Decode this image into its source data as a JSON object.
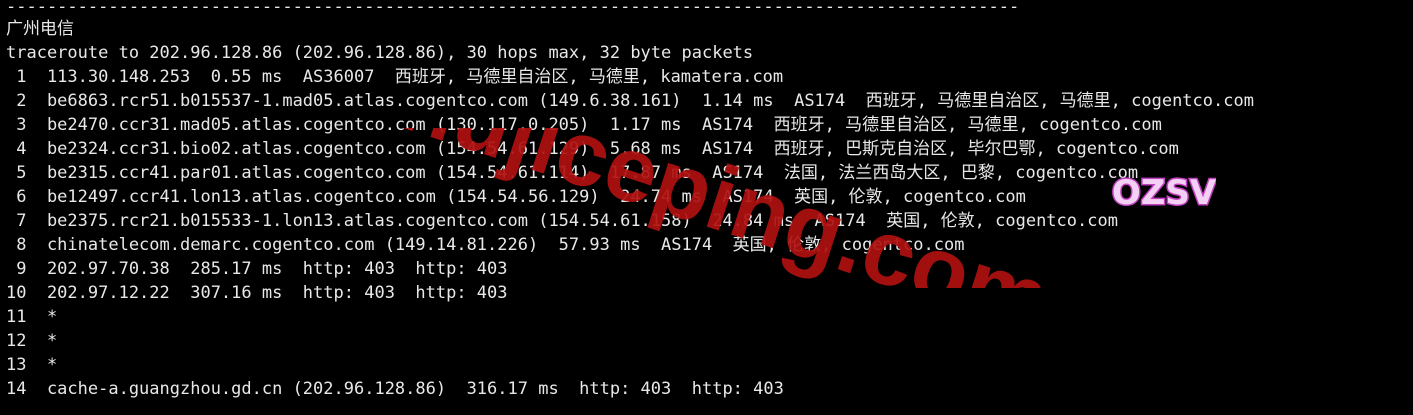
{
  "terminal": {
    "separator": "---------------------------------------------------------------------------------------------------",
    "section_title": "广州电信",
    "command": "traceroute to 202.96.128.86 (202.96.128.86), 30 hops max, 32 byte packets",
    "hops": [
      " 1  113.30.148.253  0.55 ms  AS36007  西班牙, 马德里自治区, 马德里, kamatera.com",
      " 2  be6863.rcr51.b015537-1.mad05.atlas.cogentco.com (149.6.38.161)  1.14 ms  AS174  西班牙, 马德里自治区, 马德里, cogentco.com",
      " 3  be2470.ccr31.mad05.atlas.cogentco.com (130.117.0.205)  1.17 ms  AS174  西班牙, 马德里自治区, 马德里, cogentco.com",
      " 4  be2324.ccr31.bio02.atlas.cogentco.com (154.54.61.129)  5.68 ms  AS174  西班牙, 巴斯克自治区, 毕尔巴鄂, cogentco.com",
      " 5  be2315.ccr41.par01.atlas.cogentco.com (154.54.61.114)  17.87 ms  AS174  法国, 法兰西岛大区, 巴黎, cogentco.com",
      " 6  be12497.ccr41.lon13.atlas.cogentco.com (154.54.56.129)  24.74 ms  AS174  英国, 伦敦, cogentco.com",
      " 7  be2375.rcr21.b015533-1.lon13.atlas.cogentco.com (154.54.61.158)  24.84 ms  AS174  英国, 伦敦, cogentco.com",
      " 8  chinatelecom.demarc.cogentco.com (149.14.81.226)  57.93 ms  AS174  英国, 伦敦, cogentco.com",
      " 9  202.97.70.38  285.17 ms  http: 403  http: 403",
      "10  202.97.12.22  307.16 ms  http: 403  http: 403",
      "11  *",
      "12  *",
      "13  *",
      "14  cache-a.guangzhou.gd.cn (202.96.128.86)  316.17 ms  http: 403  http: 403"
    ]
  },
  "watermark": {
    "logo_text": "OZSV",
    "url_text": "zhujiceping.com",
    "url_color": "#b01010",
    "logo_color": "#c040c0"
  },
  "colors": {
    "background": "#000000",
    "foreground": "#e8e8e8"
  }
}
